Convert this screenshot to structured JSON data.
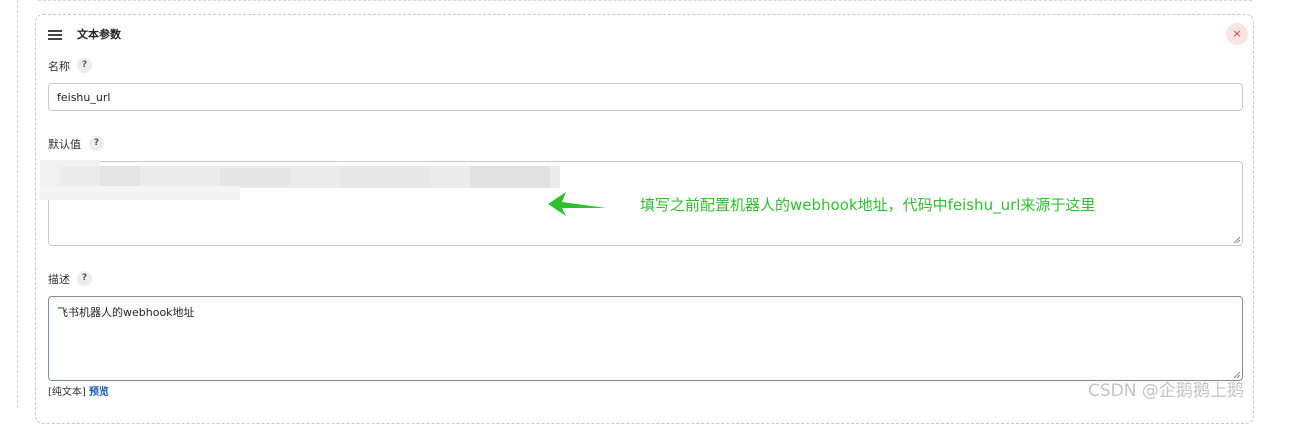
{
  "card": {
    "title": "文本参数",
    "close_glyph": "×"
  },
  "name_field": {
    "label": "名称",
    "help": "?",
    "value": "feishu_url"
  },
  "default_field": {
    "label": "默认值",
    "help": "?",
    "value": ""
  },
  "description_field": {
    "label": "描述",
    "help": "?",
    "value": "飞书机器人的webhook地址"
  },
  "footer": {
    "plain_text": "[纯文本]",
    "preview_link": "预览"
  },
  "annotation": {
    "text": "填写之前配置机器人的webhook地址，代码中feishu_url来源于这里",
    "color": "#2fbf2f"
  },
  "watermark": "CSDN @企鹅鹅上鹅",
  "icons": {
    "drag_handle": "hamburger-icon",
    "close": "close-icon",
    "help": "question-icon",
    "arrow": "left-arrow-icon"
  }
}
